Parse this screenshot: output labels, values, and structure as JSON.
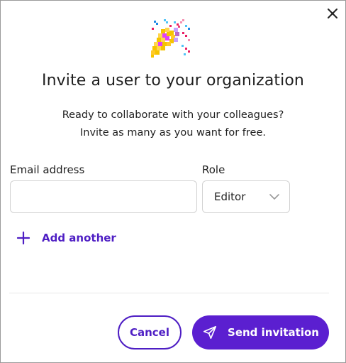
{
  "dialog": {
    "title": "Invite a user to your organization",
    "subtitle_line1": "Ready to collaborate with your colleagues?",
    "subtitle_line2": "Invite as many as you want for free.",
    "close_icon": "close-icon",
    "header_icon": "party-popper-icon"
  },
  "form": {
    "email_label": "Email address",
    "email_value": "",
    "email_placeholder": "",
    "role_label": "Role",
    "role_value": "Editor",
    "add_another_label": "Add another"
  },
  "footer": {
    "cancel_label": "Cancel",
    "send_label": "Send invitation"
  },
  "colors": {
    "accent": "#5b1fd0",
    "accent_text": "#4e1ec4",
    "border": "#d2d2d2",
    "text": "#1f1f1f"
  }
}
